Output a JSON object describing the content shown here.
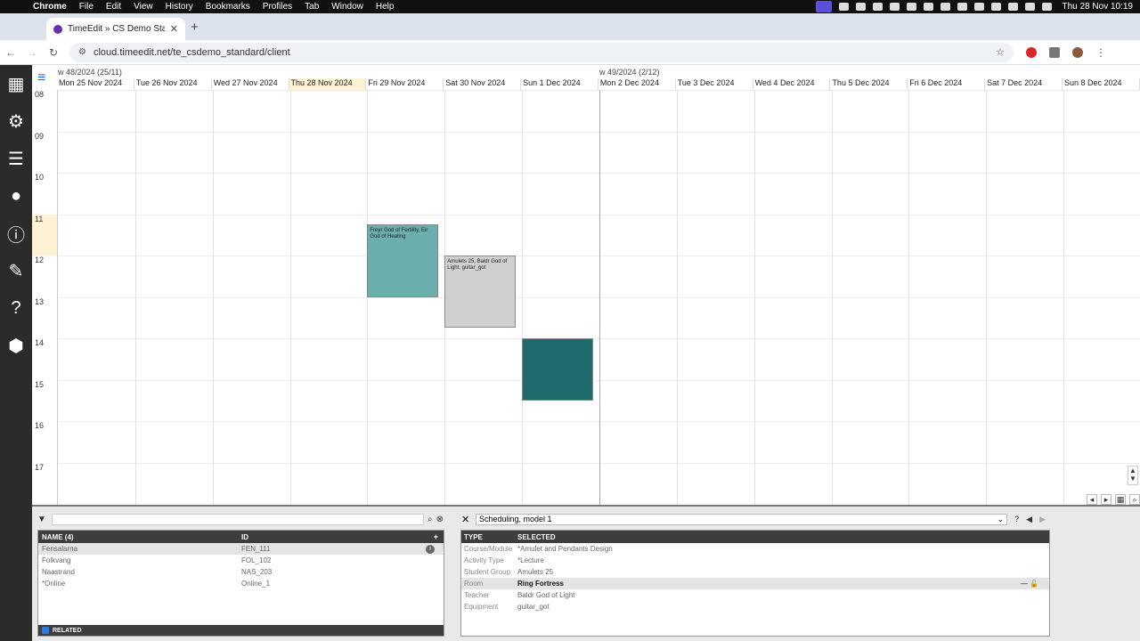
{
  "menubar": {
    "app": "Chrome",
    "items": [
      "File",
      "Edit",
      "View",
      "History",
      "Bookmarks",
      "Profiles",
      "Tab",
      "Window",
      "Help"
    ],
    "clock": "Thu 28 Nov  10:19"
  },
  "browser": {
    "tab_title": "TimeEdit » CS Demo Standard",
    "url": "cloud.timeedit.net/te_csdemo_standard/client"
  },
  "calendar": {
    "weeks": [
      {
        "label": "w 48/2024 (25/11)"
      },
      {
        "label": "w 49/2024 (2/12)"
      }
    ],
    "days": [
      {
        "label": "Mon 25 Nov 2024"
      },
      {
        "label": "Tue 26 Nov 2024"
      },
      {
        "label": "Wed 27 Nov 2024"
      },
      {
        "label": "Thu 28 Nov 2024",
        "today": true
      },
      {
        "label": "Fri 29 Nov 2024"
      },
      {
        "label": "Sat 30 Nov 2024"
      },
      {
        "label": "Sun 1 Dec 2024"
      },
      {
        "label": "Mon 2 Dec 2024"
      },
      {
        "label": "Tue 3 Dec 2024"
      },
      {
        "label": "Wed 4 Dec 2024"
      },
      {
        "label": "Thu 5 Dec 2024"
      },
      {
        "label": "Fri 6 Dec 2024"
      },
      {
        "label": "Sat 7 Dec 2024"
      },
      {
        "label": "Sun 8 Dec 2024"
      }
    ],
    "hours": [
      "08",
      "09",
      "10",
      "11",
      "12",
      "13",
      "14",
      "15",
      "16",
      "17"
    ],
    "current_hour": "11",
    "events": [
      {
        "day": 4,
        "start": 11.25,
        "end": 13.0,
        "text": "Freyr God of Fertility, Eir God of Healing",
        "color": "#6aaeae"
      },
      {
        "day": 5,
        "start": 12.0,
        "end": 13.75,
        "text": "Amulets 25, Baldr God of Light, guitar_got",
        "color": "#d0d0d0"
      },
      {
        "day": 6,
        "start": 14.0,
        "end": 15.5,
        "text": "",
        "color": "#1e6b6b"
      }
    ]
  },
  "objects": {
    "headers": {
      "name": "NAME (4)",
      "id": "ID"
    },
    "rows": [
      {
        "name": "Fensalarna",
        "id": "FEN_111",
        "selected": true
      },
      {
        "name": "Folkvang",
        "id": "FOL_102"
      },
      {
        "name": "Naastrand",
        "id": "NAS_203"
      },
      {
        "name": "*Online",
        "id": "Online_1"
      }
    ],
    "related_label": "RELATED"
  },
  "scheduling": {
    "model": "Scheduling, model 1",
    "headers": {
      "type": "TYPE",
      "selected": "SELECTED"
    },
    "rows": [
      {
        "type": "Course/Module",
        "value": "*Amulet and Pendants Design"
      },
      {
        "type": "Activity Type",
        "value": "*Lecture"
      },
      {
        "type": "Student Group",
        "value": "Amulets 25"
      },
      {
        "type": "Room",
        "value": "Ring Fortress",
        "selected": true
      },
      {
        "type": "Teacher",
        "value": "Baldr God of Light"
      },
      {
        "type": "Equipment",
        "value": "guitar_got"
      }
    ]
  }
}
